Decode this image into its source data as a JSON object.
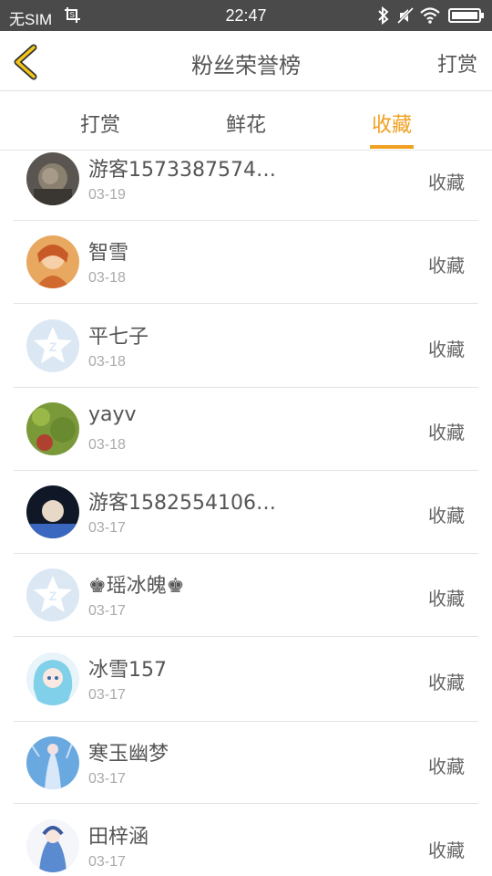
{
  "status_bar": {
    "carrier": "无SIM",
    "time": "22:47"
  },
  "header": {
    "title": "粉丝荣誉榜",
    "right_action": "打赏"
  },
  "tabs": [
    {
      "label": "打赏",
      "active": false
    },
    {
      "label": "鲜花",
      "active": false
    },
    {
      "label": "收藏",
      "active": true
    }
  ],
  "colors": {
    "accent": "#f0a020",
    "status_bar": "#4a4a4a"
  },
  "fans": [
    {
      "name": "游客1573387574…",
      "date": "03-19",
      "action": "收藏",
      "avatar": "photo-avatar"
    },
    {
      "name": "智雪",
      "date": "03-18",
      "action": "收藏",
      "avatar": "anime-avatar"
    },
    {
      "name": "平七子",
      "date": "03-18",
      "action": "收藏",
      "avatar": "default-star-avatar"
    },
    {
      "name": "yayv",
      "date": "03-18",
      "action": "收藏",
      "avatar": "photo-avatar"
    },
    {
      "name": "游客1582554106…",
      "date": "03-17",
      "action": "收藏",
      "avatar": "anime-avatar"
    },
    {
      "name": "♚瑶冰魄♚",
      "date": "03-17",
      "action": "收藏",
      "avatar": "default-star-avatar"
    },
    {
      "name": "冰雪157",
      "date": "03-17",
      "action": "收藏",
      "avatar": "anime-avatar"
    },
    {
      "name": "寒玉幽梦",
      "date": "03-17",
      "action": "收藏",
      "avatar": "anime-avatar"
    },
    {
      "name": "田梓涵",
      "date": "03-17",
      "action": "收藏",
      "avatar": "anime-avatar"
    }
  ]
}
